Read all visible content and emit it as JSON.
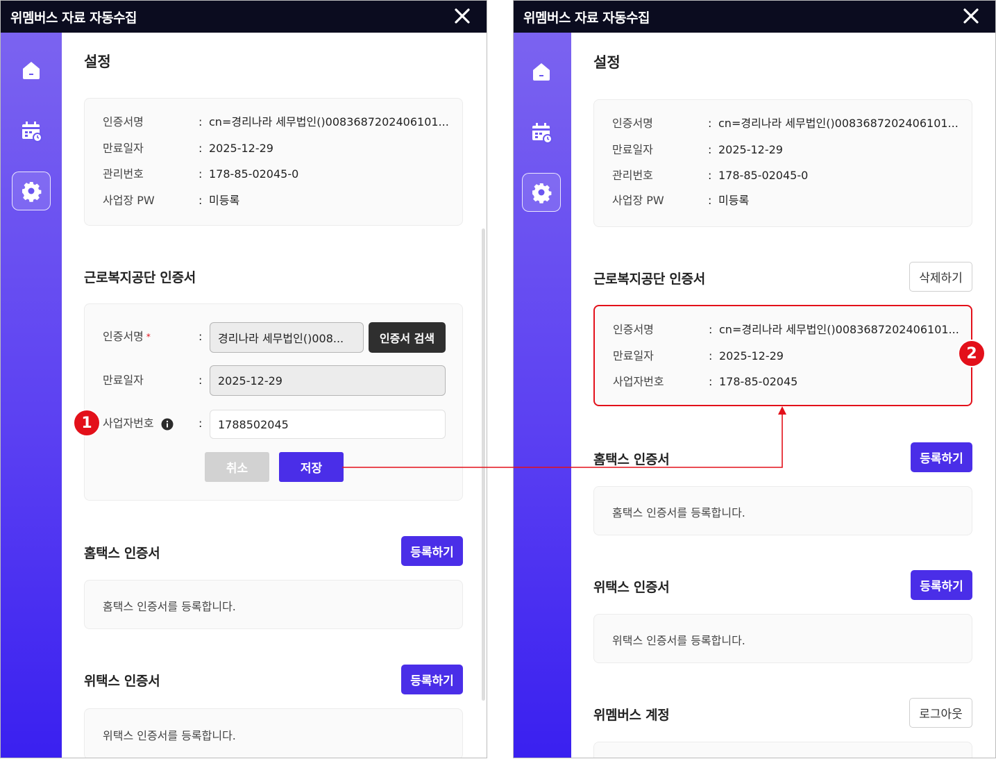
{
  "app": {
    "title": "위멤버스 자료 자동수집"
  },
  "sidebar": {
    "items": [
      {
        "icon": "home-icon"
      },
      {
        "icon": "calendar-icon"
      },
      {
        "icon": "gear-icon",
        "active": true
      }
    ]
  },
  "settings": {
    "page_title": "설정",
    "cert_info": {
      "labels": [
        "인증서명",
        "만료일자",
        "관리번호",
        "사업장 PW"
      ],
      "values": [
        "cn=경리나라 세무법인()0083687202406101...",
        "2025-12-29",
        "178-85-02045-0",
        "미등록"
      ]
    },
    "colon": ":"
  },
  "welfare": {
    "title": "근로복지공단 인증서",
    "form": {
      "cert_label": "인증서명",
      "required_mark": "*",
      "cert_value": "경리나라 세무법인()008...",
      "search_button": "인증서 검색",
      "expiry_label": "만료일자",
      "expiry_value": "2025-12-29",
      "bizno_label": "사업자번호",
      "bizno_value": "1788502045",
      "cancel_button": "취소",
      "save_button": "저장"
    },
    "saved": {
      "delete_button": "삭제하기",
      "labels": [
        "인증서명",
        "만료일자",
        "사업자번호"
      ],
      "values": [
        "cn=경리나라 세무법인()0083687202406101...",
        "2025-12-29",
        "178-85-02045"
      ]
    }
  },
  "hometax": {
    "title": "홈택스 인증서",
    "register_button": "등록하기",
    "message": "홈택스 인증서를 등록합니다."
  },
  "wetax": {
    "title": "위택스 인증서",
    "register_button": "등록하기",
    "message": "위택스 인증서를 등록합니다."
  },
  "account": {
    "title": "위멤버스 계정",
    "logout_button": "로그아웃"
  },
  "annotations": {
    "step1": "1",
    "step2": "2",
    "highlight_color": "#e3101a"
  },
  "colors": {
    "accent": "#4a2ee8",
    "titlebar": "#0b0c1f",
    "sidebar_top": "#7b63f0",
    "sidebar_bottom": "#3a20f0"
  }
}
